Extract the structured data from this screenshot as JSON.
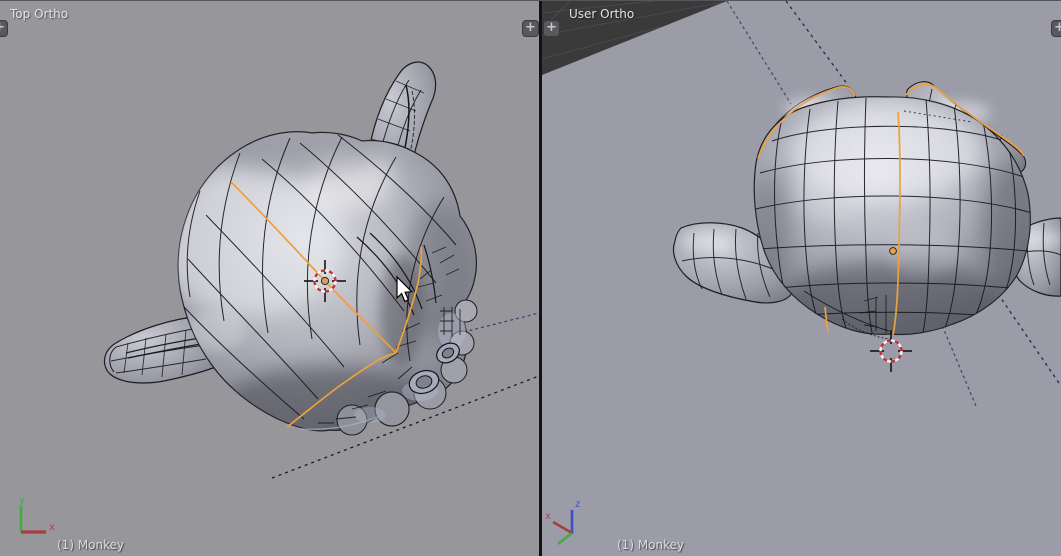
{
  "app": {
    "name": "Blender",
    "context": "Edit Mode dual 3D viewport"
  },
  "left_viewport": {
    "view_label": "Top Ortho",
    "object_info": "(1) Monkey",
    "axis_labels": {
      "x": "x",
      "y": "y"
    },
    "add_view_button": "+"
  },
  "right_viewport": {
    "view_label": "User Ortho",
    "object_info": "(1) Monkey",
    "axis_labels": {
      "x": "x",
      "z": "z"
    },
    "add_view_button": "+"
  },
  "mesh": {
    "object_name": "Monkey",
    "selection": "edge loop"
  },
  "colors": {
    "left_background": "#97979b",
    "right_background": "#9b9ca8",
    "horizon_dark": "#3a3a3a",
    "selection_orange": "#eda13d",
    "wireframe": "#17171b",
    "cursor_red": "#c23434",
    "axis_x_red": "#a6403a",
    "axis_y_green": "#3fae3f",
    "axis_z_blue": "#3c4ec0",
    "label_text": "#e3e3e3"
  }
}
